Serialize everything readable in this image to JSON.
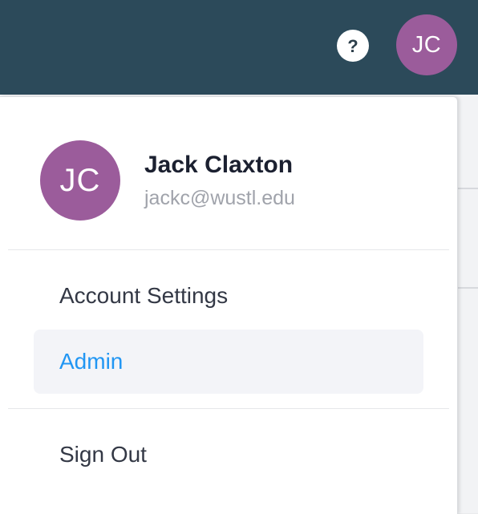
{
  "header": {
    "help_icon": "question-circle-icon",
    "help_symbol": "?",
    "user_initials": "JC"
  },
  "profile": {
    "initials": "JC",
    "name": "Jack Claxton",
    "email": "jackc@wustl.edu"
  },
  "menu": {
    "account_settings": "Account Settings",
    "admin": "Admin",
    "sign_out": "Sign Out"
  },
  "colors": {
    "topbar": "#2c4a5a",
    "avatar": "#9b5c9b",
    "active_text": "#2196f3",
    "active_bg": "#f3f4f8"
  }
}
